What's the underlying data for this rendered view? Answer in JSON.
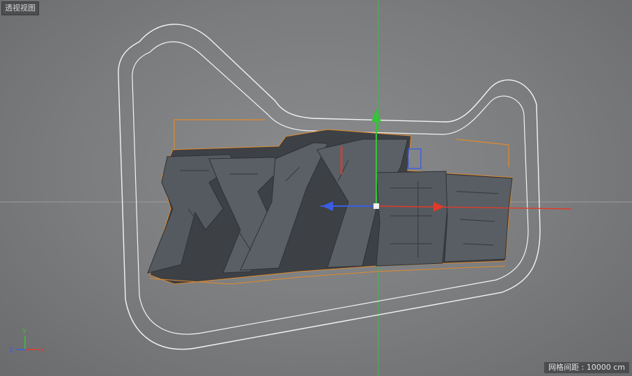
{
  "viewport": {
    "title": "透视视图",
    "grid_spacing_label": "网格间距 : 10000 cm",
    "axis_indicator": {
      "x_label": "X",
      "y_label": "Y",
      "z_label": "Z"
    },
    "colors": {
      "background": "#7f8082",
      "selection_outline": "#e08a2c",
      "spline": "#f2f2f2",
      "axis_x": "#e03a2a",
      "axis_y": "#35c43a",
      "axis_z": "#3a5ee0",
      "text_extrude": "#4e5257"
    },
    "object_text": "双11狂欢"
  }
}
